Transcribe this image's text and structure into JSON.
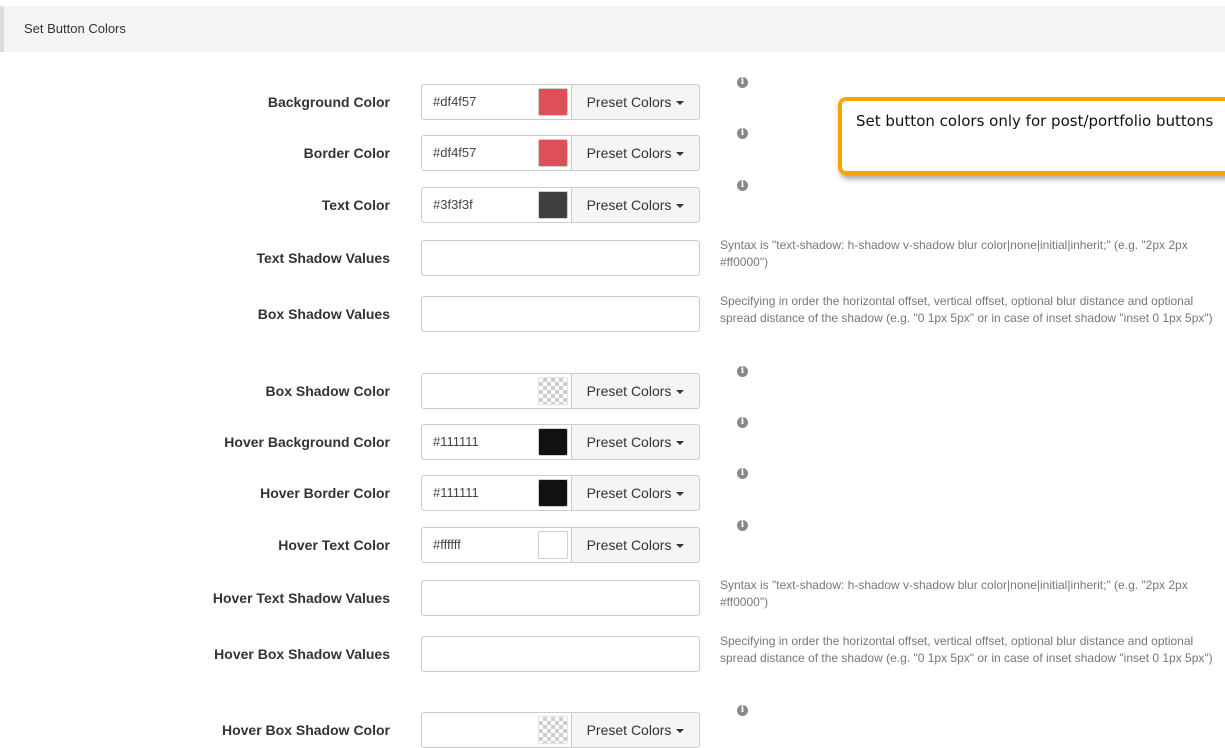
{
  "header": {
    "title": "Set Button Colors"
  },
  "callout": {
    "text": "Set button colors only for post/portfolio buttons"
  },
  "preset_label": "Preset Colors",
  "fields": {
    "background_color": {
      "label": "Background Color",
      "value": "#df4f57",
      "swatch": "#df4f57"
    },
    "border_color": {
      "label": "Border Color",
      "value": "#df4f57",
      "swatch": "#df4f57"
    },
    "text_color": {
      "label": "Text Color",
      "value": "#3f3f3f",
      "swatch": "#3f3f3f"
    },
    "text_shadow": {
      "label": "Text Shadow Values",
      "value": "",
      "help": "Syntax is \"text-shadow: h-shadow v-shadow blur color|none|initial|inherit;\" (e.g. \"2px 2px #ff0000\")"
    },
    "box_shadow": {
      "label": "Box Shadow Values",
      "value": "",
      "help": "Specifying in order the horizontal offset, vertical offset, optional blur distance and optional spread distance of the shadow (e.g. \"0 1px 5px\" or in case of inset shadow \"inset 0 1px 5px\")"
    },
    "box_shadow_color": {
      "label": "Box Shadow Color",
      "value": "",
      "swatch": "transparent"
    },
    "hover_background_color": {
      "label": "Hover Background Color",
      "value": "#111111",
      "swatch": "#111111"
    },
    "hover_border_color": {
      "label": "Hover Border Color",
      "value": "#111111",
      "swatch": "#111111"
    },
    "hover_text_color": {
      "label": "Hover Text Color",
      "value": "#ffffff",
      "swatch": "#ffffff"
    },
    "hover_text_shadow": {
      "label": "Hover Text Shadow Values",
      "value": "",
      "help": "Syntax is \"text-shadow: h-shadow v-shadow blur color|none|initial|inherit;\" (e.g. \"2px 2px #ff0000\")"
    },
    "hover_box_shadow": {
      "label": "Hover Box Shadow Values",
      "value": "",
      "help": "Specifying in order the horizontal offset, vertical offset, optional blur distance and optional spread distance of the shadow (e.g. \"0 1px 5px\" or in case of inset shadow \"inset 0 1px 5px\")"
    },
    "hover_box_shadow_color": {
      "label": "Hover Box Shadow Color",
      "value": "",
      "swatch": "transparent"
    }
  },
  "icons": {
    "info": "info-circle-icon",
    "dropdown": "caret-down-icon"
  },
  "colors": {
    "callout_border": "#f7a400",
    "header_bg": "#f4f4f4"
  }
}
